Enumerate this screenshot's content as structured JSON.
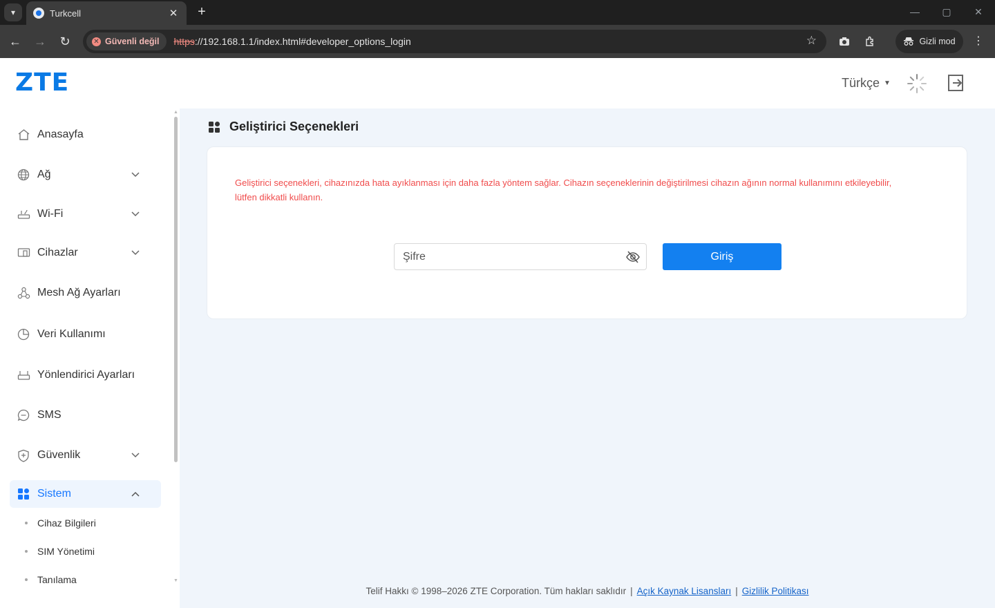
{
  "browser": {
    "tab_title": "Turkcell",
    "security_chip": "Güvenli değil",
    "url_scheme": "https",
    "url_rest": "://192.168.1.1/index.html#developer_options_login",
    "incognito_label": "Gizli mod"
  },
  "header": {
    "logo": "ZTE",
    "language": "Türkçe"
  },
  "sidebar": {
    "items": [
      {
        "label": "Anasayfa",
        "icon": "home-icon"
      },
      {
        "label": "Ağ",
        "icon": "globe-icon",
        "expandable": true
      },
      {
        "label": "Wi-Fi",
        "icon": "router-icon",
        "expandable": true
      },
      {
        "label": "Cihazlar",
        "icon": "devices-icon",
        "expandable": true
      },
      {
        "label": "Mesh Ağ Ayarları",
        "icon": "mesh-icon"
      },
      {
        "label": "Veri Kullanımı",
        "icon": "pie-chart-icon"
      },
      {
        "label": "Yönlendirici Ayarları",
        "icon": "router-settings-icon"
      },
      {
        "label": "SMS",
        "icon": "message-icon"
      },
      {
        "label": "Güvenlik",
        "icon": "shield-icon",
        "expandable": true
      },
      {
        "label": "Sistem",
        "icon": "grid-icon",
        "expandable": true,
        "expanded": true,
        "active": true
      }
    ],
    "subitems": [
      {
        "label": "Cihaz Bilgileri"
      },
      {
        "label": "SIM Yönetimi"
      },
      {
        "label": "Tanılama"
      }
    ]
  },
  "main": {
    "page_title": "Geliştirici Seçenekleri",
    "warning_text": "Geliştirici seçenekleri, cihazınızda hata ayıklanması için daha fazla yöntem sağlar. Cihazın seçeneklerinin değiştirilmesi cihazın ağının normal kullanımını etkileyebilir, lütfen dikkatli kullanın.",
    "password_placeholder": "Şifre",
    "password_value": "",
    "login_button": "Giriş"
  },
  "footer": {
    "copyright": "Telif Hakkı © 1998–2026 ZTE Corporation. Tüm hakları saklıdır",
    "open_source_link": "Açık Kaynak Lisansları",
    "privacy_link": "Gizlilik Politikası"
  },
  "colors": {
    "brand": "#0a7ae5",
    "primary_button": "#1380f0",
    "warning": "#f04b4b",
    "active_nav": "#1677ff"
  }
}
